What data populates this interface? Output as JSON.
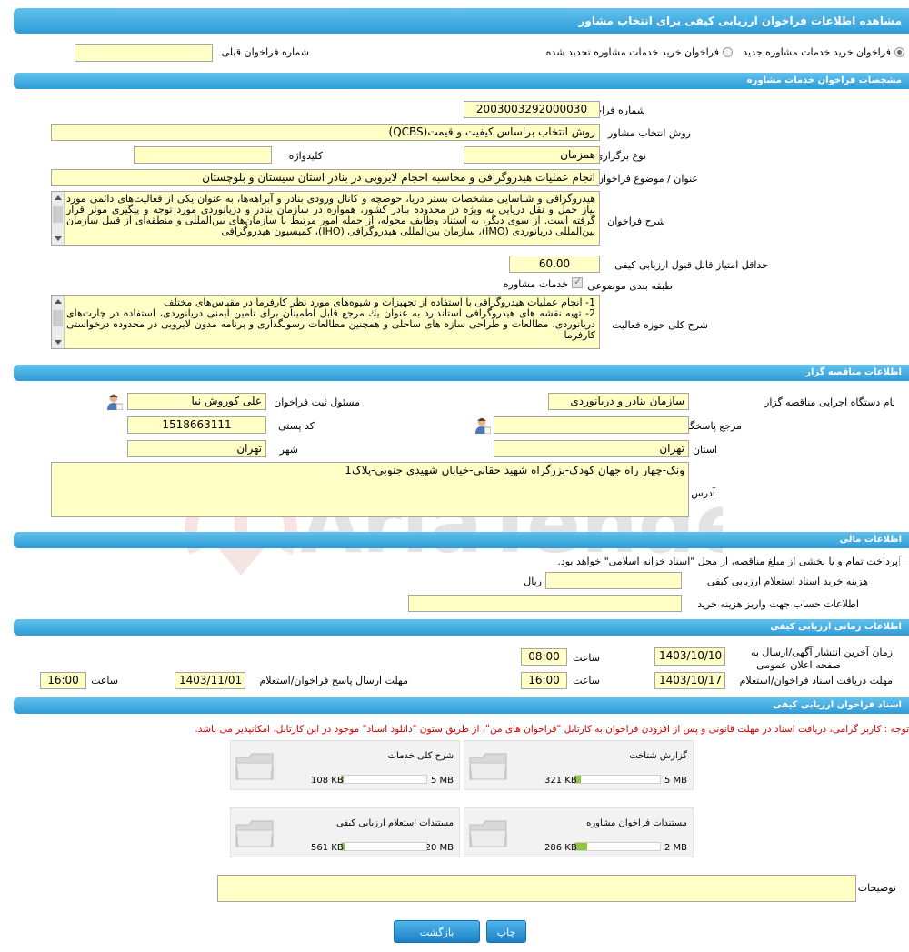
{
  "page": {
    "title": "مشاهده اطلاعات فراخوان ارزیابی کیفی برای انتخاب مشاور"
  },
  "top": {
    "radio_new": "فراخوان خرید خدمات مشاوره جدید",
    "radio_renew": "فراخوان خرید خدمات مشاوره تجدید شده",
    "prev_number_label": "شماره فراخوان قبلی",
    "prev_number_value": ""
  },
  "spec": {
    "header": "مشخصات فراخوان خدمات مشاوره",
    "number_label": "شماره فراخوان",
    "number_value": "2003003292000030",
    "method_label": "روش انتخاب مشاور",
    "method_value": "روش انتخاب براساس کیفیت و قیمت(QCBS)",
    "type_label": "نوع برگزاری",
    "type_value": "همزمان",
    "keyword_label": "کلیدواژه",
    "keyword_value": "",
    "subject_label": "عنوان / موضوع فراخوان",
    "subject_value": "انجام عملیات هیدروگرافی و محاسبه احجام لایروبی در بنادر استان سیستان و بلوچستان",
    "desc_label": "شرح فراخوان",
    "desc_value": "هیدروگرافی و شناسایی مشخصات بستر دریا، حوضچه و کانال ورودی بنادر و آبراهه‌ها، به عنوان یکی از فعالیت‌های دائمی مورد نیاز حمل و نقل دریایی به ویژه در محدوده بنادر کشور، همواره در سازمان بنادر و دریانوردی مورد توجه و پیگیری موثر قرار گرفته است. از سوی دیگر، به استناد وظایف محوله، از جمله امور مرتبط با سازمان‌های بین‌المللی و منطقه‌ای از قبیل سازمان بین‌المللی دریانوردی (IMO)، سازمان بین‌المللی هیدروگرافی (IHO)، کمیسیون هیدروگرافی",
    "min_score_label": "حداقل امتیاز قابل قبول ارزیابی کیفی",
    "min_score_value": "60.00",
    "category_label": "طبقه بندی موضوعی",
    "category_value": "خدمات مشاوره",
    "scope_label": "شرح کلی حوزه فعالیت",
    "scope_lines": [
      "1-    انجام عملیات هیدروگرافی با استفاده از تجهیزات و شیوه‌های مورد نظر کارفرما در مقیاس‌های مختلف",
      "2-    تهیه نقشه های هیدروگرافی استاندارد به عنوان یك مرجع قابل اطمینان برای تامین ایمنی دریانوردی، استفاده در چارت‌های دریانوردی، مطالعات و طراحی سازه های ساحلی و همچنین مطالعات رسوبگذاری و برنامه مدون لایروبی در محدوده درخواستی کارفرما"
    ]
  },
  "tenderer": {
    "header": "اطلاعات مناقصه گزار",
    "org_label": "نام دستگاه اجرایی مناقصه گزار",
    "org_value": "سازمان بنادر و دریانوردی",
    "registrar_label": "مسئول ثبت فراخوان",
    "registrar_value": "علی کوروش نیا",
    "ref_label": "مرجع پاسخگویی",
    "ref_value": "",
    "postal_label": "کد پستی",
    "postal_value": "1518663111",
    "province_label": "استان",
    "province_value": "تهران",
    "city_label": "شهر",
    "city_value": "تهران",
    "address_label": "آدرس",
    "address_value": "ونک-چهار راه جهان کودک-بزرگراه شهید حقانی-خیابان شهیدی جنوبی-پلاک1"
  },
  "finance": {
    "header": "اطلاعات مالی",
    "treasury_text": "پرداخت تمام و یا بخشی از مبلغ مناقصه، از محل \"اسناد خزانه اسلامی\" خواهد بود.",
    "fee_label": "هزینه خرید اسناد استعلام ارزیابی کیفی",
    "fee_value": "",
    "fee_unit": "ریال",
    "account_label": "اطلاعات حساب جهت واریز هزینه خرید",
    "account_value": ""
  },
  "timing": {
    "header": "اطلاعات زمانی ارزیابی کیفی",
    "publish_label_1": "زمان آخرین انتشار آگهی/ارسال به",
    "publish_label_2": "صفحه اعلان عمومی",
    "publish_date": "1403/10/10",
    "publish_time": "08:00",
    "receive_label": "مهلت دریافت اسناد فراخوان/استعلام",
    "receive_date": "1403/10/17",
    "receive_time": "16:00",
    "submit_label": "مهلت ارسال پاسخ فراخوان/استعلام",
    "submit_date": "1403/11/01",
    "submit_time": "16:00",
    "time_label": "ساعت"
  },
  "docs": {
    "header": "اسناد فراخوان ارزیابی کیفی",
    "note": "توجه : کاربر گرامی، دریافت اسناد در مهلت قانونی و پس از افزودن فراخوان به کارتابل \"فراخوان های من\"، از طریق ستون \"دانلود اسناد\" موجود در این کارتابل، امکانپذیر می باشد.",
    "items": [
      {
        "title": "گزارش شناخت",
        "size": "321 KB",
        "max": "5 MB",
        "fill": 0.062
      },
      {
        "title": "شرح کلی خدمات",
        "size": "108 KB",
        "max": "5 MB",
        "fill": 0.021
      },
      {
        "title": "مستندات فراخوان مشاوره",
        "size": "286 KB",
        "max": "2 MB",
        "fill": 0.14
      },
      {
        "title": "مستندات استعلام ارزیابی کیفی",
        "size": "561 KB",
        "max": "20 MB",
        "fill": 0.027
      }
    ],
    "notes_label": "توضیحات",
    "notes_value": ""
  },
  "buttons": {
    "print": "چاپ",
    "back": "بازگشت"
  },
  "watermark": "AriaTender.neT",
  "colors": {
    "header": "#2e9bd6",
    "field": "#ffffc6",
    "warning": "#d40000",
    "progress": "#8dc63f",
    "button": "#1b7fc6"
  }
}
